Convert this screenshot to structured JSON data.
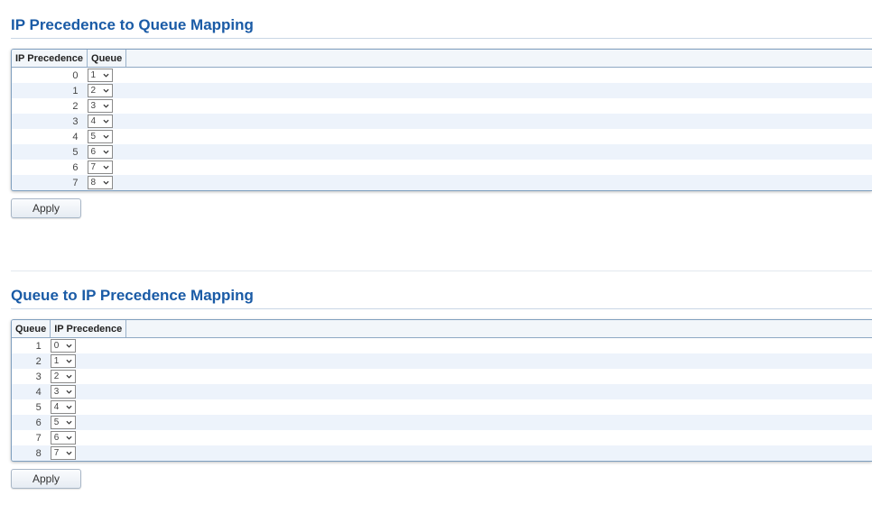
{
  "sections": {
    "precedence_to_queue": {
      "title": "IP Precedence to Queue Mapping",
      "col_key": "IP Precedence",
      "col_val": "Queue",
      "rows": [
        {
          "key": "0",
          "val": "1"
        },
        {
          "key": "1",
          "val": "2"
        },
        {
          "key": "2",
          "val": "3"
        },
        {
          "key": "3",
          "val": "4"
        },
        {
          "key": "4",
          "val": "5"
        },
        {
          "key": "5",
          "val": "6"
        },
        {
          "key": "6",
          "val": "7"
        },
        {
          "key": "7",
          "val": "8"
        }
      ],
      "apply_label": "Apply"
    },
    "queue_to_precedence": {
      "title": "Queue to IP Precedence Mapping",
      "col_key": "Queue",
      "col_val": "IP Precedence",
      "rows": [
        {
          "key": "1",
          "val": "0"
        },
        {
          "key": "2",
          "val": "1"
        },
        {
          "key": "3",
          "val": "2"
        },
        {
          "key": "4",
          "val": "3"
        },
        {
          "key": "5",
          "val": "4"
        },
        {
          "key": "6",
          "val": "5"
        },
        {
          "key": "7",
          "val": "6"
        },
        {
          "key": "8",
          "val": "7"
        }
      ],
      "apply_label": "Apply"
    }
  },
  "colors": {
    "title": "#1a5ba6",
    "row_alt": "#edf3fb",
    "panel_border": "#7f9fbf"
  }
}
